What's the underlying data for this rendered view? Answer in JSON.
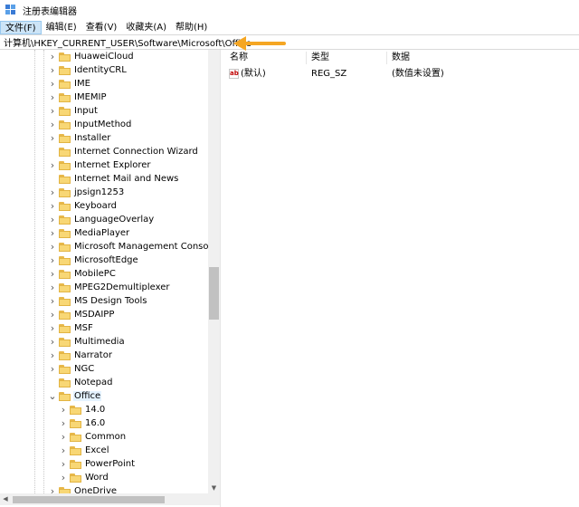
{
  "window": {
    "title": "注册表编辑器"
  },
  "menu": [
    "文件(F)",
    "编辑(E)",
    "查看(V)",
    "收藏夹(A)",
    "帮助(H)"
  ],
  "address": "计算机\\HKEY_CURRENT_USER\\Software\\Microsoft\\Office",
  "tree": [
    {
      "label": "HuaweiCloud",
      "level": 0,
      "expander": "collapsed"
    },
    {
      "label": "IdentityCRL",
      "level": 0,
      "expander": "collapsed"
    },
    {
      "label": "IME",
      "level": 0,
      "expander": "collapsed"
    },
    {
      "label": "IMEMIP",
      "level": 0,
      "expander": "collapsed"
    },
    {
      "label": "Input",
      "level": 0,
      "expander": "collapsed"
    },
    {
      "label": "InputMethod",
      "level": 0,
      "expander": "collapsed"
    },
    {
      "label": "Installer",
      "level": 0,
      "expander": "collapsed"
    },
    {
      "label": "Internet Connection Wizard",
      "level": 0,
      "expander": "none"
    },
    {
      "label": "Internet Explorer",
      "level": 0,
      "expander": "collapsed"
    },
    {
      "label": "Internet Mail and News",
      "level": 0,
      "expander": "none"
    },
    {
      "label": "jpsign1253",
      "level": 0,
      "expander": "collapsed"
    },
    {
      "label": "Keyboard",
      "level": 0,
      "expander": "collapsed"
    },
    {
      "label": "LanguageOverlay",
      "level": 0,
      "expander": "collapsed"
    },
    {
      "label": "MediaPlayer",
      "level": 0,
      "expander": "collapsed"
    },
    {
      "label": "Microsoft Management Console",
      "level": 0,
      "expander": "collapsed"
    },
    {
      "label": "MicrosoftEdge",
      "level": 0,
      "expander": "collapsed"
    },
    {
      "label": "MobilePC",
      "level": 0,
      "expander": "collapsed"
    },
    {
      "label": "MPEG2Demultiplexer",
      "level": 0,
      "expander": "collapsed"
    },
    {
      "label": "MS Design Tools",
      "level": 0,
      "expander": "collapsed"
    },
    {
      "label": "MSDAIPP",
      "level": 0,
      "expander": "collapsed"
    },
    {
      "label": "MSF",
      "level": 0,
      "expander": "collapsed"
    },
    {
      "label": "Multimedia",
      "level": 0,
      "expander": "collapsed"
    },
    {
      "label": "Narrator",
      "level": 0,
      "expander": "collapsed"
    },
    {
      "label": "NGC",
      "level": 0,
      "expander": "collapsed"
    },
    {
      "label": "Notepad",
      "level": 0,
      "expander": "none"
    },
    {
      "label": "Office",
      "level": 0,
      "expander": "expanded",
      "selected": true
    },
    {
      "label": "14.0",
      "level": 1,
      "expander": "collapsed"
    },
    {
      "label": "16.0",
      "level": 1,
      "expander": "collapsed"
    },
    {
      "label": "Common",
      "level": 1,
      "expander": "collapsed"
    },
    {
      "label": "Excel",
      "level": 1,
      "expander": "collapsed"
    },
    {
      "label": "PowerPoint",
      "level": 1,
      "expander": "collapsed"
    },
    {
      "label": "Word",
      "level": 1,
      "expander": "collapsed"
    },
    {
      "label": "OneDrive",
      "level": 0,
      "expander": "collapsed"
    }
  ],
  "columns": {
    "name": "名称",
    "type": "类型",
    "data": "数据"
  },
  "values": [
    {
      "name": "(默认)",
      "type": "REG_SZ",
      "data": "(数值未设置)"
    }
  ],
  "colors": {
    "selected_bg": "#e5f3ff",
    "folder": "#f8d775",
    "arrow": "#f5a623",
    "menu_active": "#cce4f7"
  }
}
